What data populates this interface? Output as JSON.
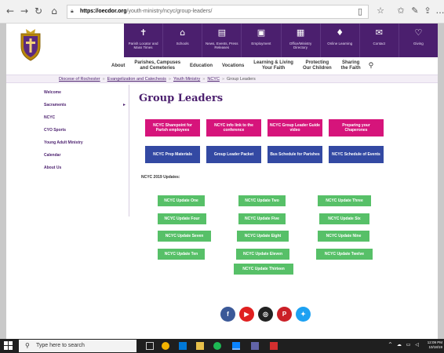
{
  "browser": {
    "url_domain": "https://oecdor.org",
    "url_path": "/youth-ministry/ncyc/group-leaders/"
  },
  "top_nav": [
    {
      "label": "Parish Locator and Mass Times",
      "icon": "cross-icon"
    },
    {
      "label": "Schools",
      "icon": "school-icon"
    },
    {
      "label": "News, Events, Press Releases",
      "icon": "newspaper-icon"
    },
    {
      "label": "Employment",
      "icon": "briefcase-icon"
    },
    {
      "label": "Office/Ministry Directory",
      "icon": "directory-icon"
    },
    {
      "label": "Online Learning",
      "icon": "lightbulb-icon"
    },
    {
      "label": "Contact",
      "icon": "envelope-icon"
    },
    {
      "label": "Giving",
      "icon": "heart-icon"
    }
  ],
  "main_nav": [
    "About",
    "Parishes, Campuses\nand Cemeteries",
    "Education",
    "Vocations",
    "Learning & Living\nYour Faith",
    "Protecting\nOur Children",
    "Sharing\nthe Faith"
  ],
  "breadcrumb": {
    "links": [
      "Diocese of Rochester",
      "Evangelization and Catechesis",
      "Youth Ministry",
      "NCYC"
    ],
    "separator": "»",
    "current": "Group Leaders"
  },
  "sidebar": {
    "items": [
      "Welcome",
      "Sacraments",
      "NCYC",
      "CYO Sports",
      "Young Adult Ministry",
      "Calendar",
      "About Us"
    ]
  },
  "page_title": "Group Leaders",
  "doc_buttons": [
    "NCYC Sharepoint for Parish employees",
    "NCYC info link to the conference",
    "NCYC Group Leader Guide video",
    "Preparing your Chaperones",
    "NCYC Prep Materials",
    "Group Leader Packet",
    "Bus Schedule for Parishes",
    "NCYC Schedule of Events"
  ],
  "updates_label": "NCYC 2019 Updates:",
  "updates": [
    "NCYC Update One",
    "NCYC Update Two",
    "NCYC Update Three",
    "NCYC Update Four",
    "NCYC Update Five",
    "NCYC Update Six",
    "NCYC Update Seven",
    "NCYC Update Eight",
    "NCYC Update Nine",
    "NCYC Update Ten",
    "NCYC Update Eleven",
    "NCYC Update Twelve",
    "NCYC Update Thirteen"
  ],
  "social": [
    {
      "icon": "facebook-icon",
      "glyph": "f",
      "color": "#3b5998"
    },
    {
      "icon": "youtube-icon",
      "glyph": "▶",
      "color": "#e02020"
    },
    {
      "icon": "instagram-icon",
      "glyph": "◎",
      "color": "#222222"
    },
    {
      "icon": "pinterest-icon",
      "glyph": "P",
      "color": "#cb2027"
    },
    {
      "icon": "twitter-icon",
      "glyph": "✦",
      "color": "#1da1f2"
    }
  ],
  "taskbar": {
    "search_placeholder": "Type here to search",
    "time": "12:09 PM",
    "date": "10/18/19"
  },
  "colors": {
    "brand_purple": "#4b1f6e",
    "magenta": "#d6147b",
    "blue": "#3349a3",
    "green": "#57c068"
  }
}
